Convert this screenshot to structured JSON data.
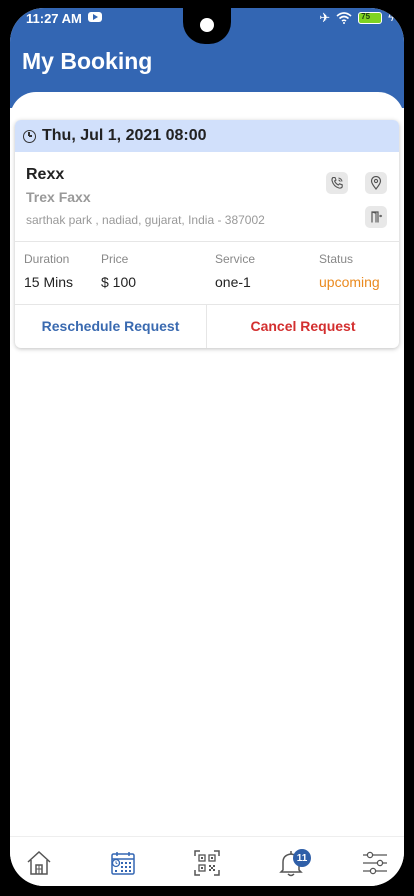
{
  "status_bar": {
    "time": "11:27 AM",
    "battery": "75"
  },
  "header": {
    "title": "My Booking"
  },
  "booking": {
    "datetime": "Thu, Jul 1, 2021 08:00",
    "name": "Rexx",
    "company": "Trex Faxx",
    "address": "sarthak park , nadiad, gujarat, India - 387002",
    "stats": [
      {
        "label": "Duration",
        "value": "15 Mins"
      },
      {
        "label": "Price",
        "value": "$ 100"
      },
      {
        "label": "Service",
        "value": "one-1"
      },
      {
        "label": "Status",
        "value": "upcoming"
      }
    ],
    "reschedule_label": "Reschedule Request",
    "cancel_label": "Cancel Request"
  },
  "nav": {
    "notification_count": "11"
  },
  "colors": {
    "primary": "#3366b3",
    "header_band": "#d1e0fb",
    "status_upcoming": "#ea8a1f",
    "cancel": "#d32f2f",
    "reschedule": "#3a6ab0"
  }
}
